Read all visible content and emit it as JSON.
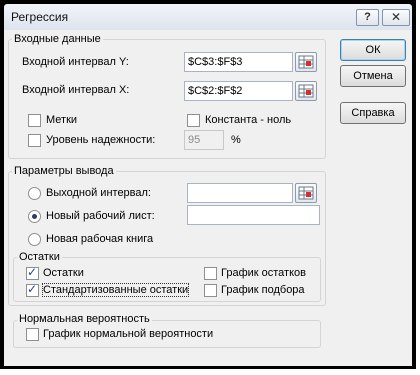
{
  "window": {
    "title": "Регрессия"
  },
  "titlebar": {
    "help_label": "?",
    "close_label": "✕"
  },
  "input_group": {
    "title": "Входные данные",
    "y_range": {
      "label": "Входной интервал Y:",
      "value": "$C$3:$F$3"
    },
    "x_range": {
      "label": "Входной интервал X:",
      "value": "$C$2:$F$2"
    },
    "labels_checkbox": {
      "label": "Метки",
      "checked": false
    },
    "const_zero_checkbox": {
      "label": "Константа - ноль",
      "checked": false
    },
    "confidence_checkbox": {
      "label": "Уровень надежности:",
      "checked": false
    },
    "confidence_value": "95",
    "confidence_unit": "%"
  },
  "output_group": {
    "title": "Параметры вывода",
    "output_range_radio": {
      "label": "Выходной интервал:",
      "selected": false,
      "value": ""
    },
    "new_sheet_radio": {
      "label": "Новый рабочий лист:",
      "selected": true,
      "value": ""
    },
    "new_book_radio": {
      "label": "Новая рабочая книга",
      "selected": false
    }
  },
  "residuals_group": {
    "title": "Остатки",
    "residuals": {
      "label": "Остатки",
      "checked": true
    },
    "std_residuals": {
      "label": "Стандартизованные остатки",
      "checked": true
    },
    "residual_plot": {
      "label": "График остатков",
      "checked": false
    },
    "line_fit_plot": {
      "label": "График подбора",
      "checked": false
    }
  },
  "normal_group": {
    "title": "Нормальная вероятность",
    "normal_plot": {
      "label": "График нормальной вероятности",
      "checked": false
    }
  },
  "buttons": {
    "ok": "ОК",
    "cancel": "Отмена",
    "help": "Справка"
  },
  "icons": {
    "ref_button": "range-select-icon",
    "check": "checkmark-icon"
  }
}
